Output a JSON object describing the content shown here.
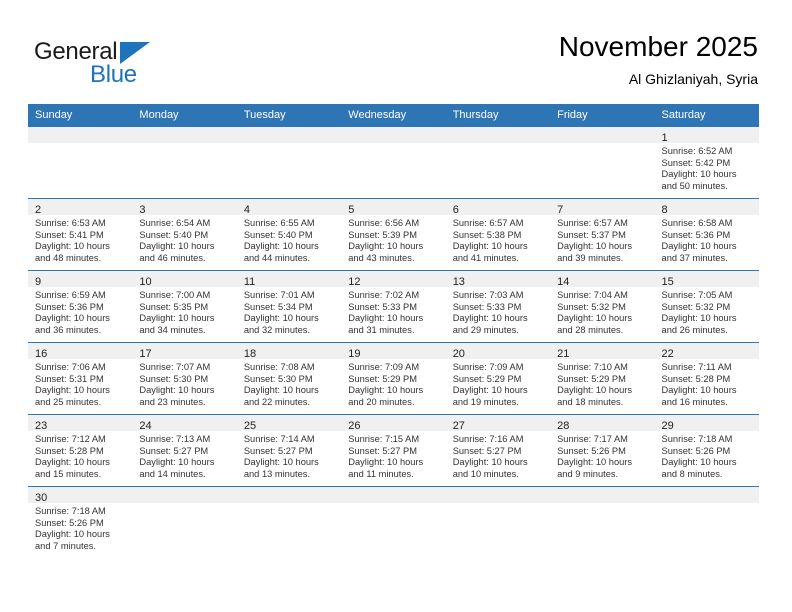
{
  "brand": {
    "name_part1": "General",
    "name_part2": "Blue"
  },
  "header": {
    "title": "November 2025",
    "subtitle": "Al Ghizlaniyah, Syria"
  },
  "weekdays": [
    "Sunday",
    "Monday",
    "Tuesday",
    "Wednesday",
    "Thursday",
    "Friday",
    "Saturday"
  ],
  "colors": {
    "header_blue": "#2e75b6",
    "brand_blue": "#1d74bb",
    "daynum_band": "#f0f0f0"
  },
  "labels": {
    "sunrise": "Sunrise:",
    "sunset": "Sunset:",
    "daylight": "Daylight:"
  },
  "weeks": [
    [
      {
        "day": "",
        "sunrise": "",
        "sunset": "",
        "daylight_line1": "",
        "daylight_line2": ""
      },
      {
        "day": "",
        "sunrise": "",
        "sunset": "",
        "daylight_line1": "",
        "daylight_line2": ""
      },
      {
        "day": "",
        "sunrise": "",
        "sunset": "",
        "daylight_line1": "",
        "daylight_line2": ""
      },
      {
        "day": "",
        "sunrise": "",
        "sunset": "",
        "daylight_line1": "",
        "daylight_line2": ""
      },
      {
        "day": "",
        "sunrise": "",
        "sunset": "",
        "daylight_line1": "",
        "daylight_line2": ""
      },
      {
        "day": "",
        "sunrise": "",
        "sunset": "",
        "daylight_line1": "",
        "daylight_line2": ""
      },
      {
        "day": "1",
        "sunrise": "Sunrise: 6:52 AM",
        "sunset": "Sunset: 5:42 PM",
        "daylight_line1": "Daylight: 10 hours",
        "daylight_line2": "and 50 minutes."
      }
    ],
    [
      {
        "day": "2",
        "sunrise": "Sunrise: 6:53 AM",
        "sunset": "Sunset: 5:41 PM",
        "daylight_line1": "Daylight: 10 hours",
        "daylight_line2": "and 48 minutes."
      },
      {
        "day": "3",
        "sunrise": "Sunrise: 6:54 AM",
        "sunset": "Sunset: 5:40 PM",
        "daylight_line1": "Daylight: 10 hours",
        "daylight_line2": "and 46 minutes."
      },
      {
        "day": "4",
        "sunrise": "Sunrise: 6:55 AM",
        "sunset": "Sunset: 5:40 PM",
        "daylight_line1": "Daylight: 10 hours",
        "daylight_line2": "and 44 minutes."
      },
      {
        "day": "5",
        "sunrise": "Sunrise: 6:56 AM",
        "sunset": "Sunset: 5:39 PM",
        "daylight_line1": "Daylight: 10 hours",
        "daylight_line2": "and 43 minutes."
      },
      {
        "day": "6",
        "sunrise": "Sunrise: 6:57 AM",
        "sunset": "Sunset: 5:38 PM",
        "daylight_line1": "Daylight: 10 hours",
        "daylight_line2": "and 41 minutes."
      },
      {
        "day": "7",
        "sunrise": "Sunrise: 6:57 AM",
        "sunset": "Sunset: 5:37 PM",
        "daylight_line1": "Daylight: 10 hours",
        "daylight_line2": "and 39 minutes."
      },
      {
        "day": "8",
        "sunrise": "Sunrise: 6:58 AM",
        "sunset": "Sunset: 5:36 PM",
        "daylight_line1": "Daylight: 10 hours",
        "daylight_line2": "and 37 minutes."
      }
    ],
    [
      {
        "day": "9",
        "sunrise": "Sunrise: 6:59 AM",
        "sunset": "Sunset: 5:36 PM",
        "daylight_line1": "Daylight: 10 hours",
        "daylight_line2": "and 36 minutes."
      },
      {
        "day": "10",
        "sunrise": "Sunrise: 7:00 AM",
        "sunset": "Sunset: 5:35 PM",
        "daylight_line1": "Daylight: 10 hours",
        "daylight_line2": "and 34 minutes."
      },
      {
        "day": "11",
        "sunrise": "Sunrise: 7:01 AM",
        "sunset": "Sunset: 5:34 PM",
        "daylight_line1": "Daylight: 10 hours",
        "daylight_line2": "and 32 minutes."
      },
      {
        "day": "12",
        "sunrise": "Sunrise: 7:02 AM",
        "sunset": "Sunset: 5:33 PM",
        "daylight_line1": "Daylight: 10 hours",
        "daylight_line2": "and 31 minutes."
      },
      {
        "day": "13",
        "sunrise": "Sunrise: 7:03 AM",
        "sunset": "Sunset: 5:33 PM",
        "daylight_line1": "Daylight: 10 hours",
        "daylight_line2": "and 29 minutes."
      },
      {
        "day": "14",
        "sunrise": "Sunrise: 7:04 AM",
        "sunset": "Sunset: 5:32 PM",
        "daylight_line1": "Daylight: 10 hours",
        "daylight_line2": "and 28 minutes."
      },
      {
        "day": "15",
        "sunrise": "Sunrise: 7:05 AM",
        "sunset": "Sunset: 5:32 PM",
        "daylight_line1": "Daylight: 10 hours",
        "daylight_line2": "and 26 minutes."
      }
    ],
    [
      {
        "day": "16",
        "sunrise": "Sunrise: 7:06 AM",
        "sunset": "Sunset: 5:31 PM",
        "daylight_line1": "Daylight: 10 hours",
        "daylight_line2": "and 25 minutes."
      },
      {
        "day": "17",
        "sunrise": "Sunrise: 7:07 AM",
        "sunset": "Sunset: 5:30 PM",
        "daylight_line1": "Daylight: 10 hours",
        "daylight_line2": "and 23 minutes."
      },
      {
        "day": "18",
        "sunrise": "Sunrise: 7:08 AM",
        "sunset": "Sunset: 5:30 PM",
        "daylight_line1": "Daylight: 10 hours",
        "daylight_line2": "and 22 minutes."
      },
      {
        "day": "19",
        "sunrise": "Sunrise: 7:09 AM",
        "sunset": "Sunset: 5:29 PM",
        "daylight_line1": "Daylight: 10 hours",
        "daylight_line2": "and 20 minutes."
      },
      {
        "day": "20",
        "sunrise": "Sunrise: 7:09 AM",
        "sunset": "Sunset: 5:29 PM",
        "daylight_line1": "Daylight: 10 hours",
        "daylight_line2": "and 19 minutes."
      },
      {
        "day": "21",
        "sunrise": "Sunrise: 7:10 AM",
        "sunset": "Sunset: 5:29 PM",
        "daylight_line1": "Daylight: 10 hours",
        "daylight_line2": "and 18 minutes."
      },
      {
        "day": "22",
        "sunrise": "Sunrise: 7:11 AM",
        "sunset": "Sunset: 5:28 PM",
        "daylight_line1": "Daylight: 10 hours",
        "daylight_line2": "and 16 minutes."
      }
    ],
    [
      {
        "day": "23",
        "sunrise": "Sunrise: 7:12 AM",
        "sunset": "Sunset: 5:28 PM",
        "daylight_line1": "Daylight: 10 hours",
        "daylight_line2": "and 15 minutes."
      },
      {
        "day": "24",
        "sunrise": "Sunrise: 7:13 AM",
        "sunset": "Sunset: 5:27 PM",
        "daylight_line1": "Daylight: 10 hours",
        "daylight_line2": "and 14 minutes."
      },
      {
        "day": "25",
        "sunrise": "Sunrise: 7:14 AM",
        "sunset": "Sunset: 5:27 PM",
        "daylight_line1": "Daylight: 10 hours",
        "daylight_line2": "and 13 minutes."
      },
      {
        "day": "26",
        "sunrise": "Sunrise: 7:15 AM",
        "sunset": "Sunset: 5:27 PM",
        "daylight_line1": "Daylight: 10 hours",
        "daylight_line2": "and 11 minutes."
      },
      {
        "day": "27",
        "sunrise": "Sunrise: 7:16 AM",
        "sunset": "Sunset: 5:27 PM",
        "daylight_line1": "Daylight: 10 hours",
        "daylight_line2": "and 10 minutes."
      },
      {
        "day": "28",
        "sunrise": "Sunrise: 7:17 AM",
        "sunset": "Sunset: 5:26 PM",
        "daylight_line1": "Daylight: 10 hours",
        "daylight_line2": "and 9 minutes."
      },
      {
        "day": "29",
        "sunrise": "Sunrise: 7:18 AM",
        "sunset": "Sunset: 5:26 PM",
        "daylight_line1": "Daylight: 10 hours",
        "daylight_line2": "and 8 minutes."
      }
    ],
    [
      {
        "day": "30",
        "sunrise": "Sunrise: 7:18 AM",
        "sunset": "Sunset: 5:26 PM",
        "daylight_line1": "Daylight: 10 hours",
        "daylight_line2": "and 7 minutes."
      },
      {
        "day": "",
        "sunrise": "",
        "sunset": "",
        "daylight_line1": "",
        "daylight_line2": ""
      },
      {
        "day": "",
        "sunrise": "",
        "sunset": "",
        "daylight_line1": "",
        "daylight_line2": ""
      },
      {
        "day": "",
        "sunrise": "",
        "sunset": "",
        "daylight_line1": "",
        "daylight_line2": ""
      },
      {
        "day": "",
        "sunrise": "",
        "sunset": "",
        "daylight_line1": "",
        "daylight_line2": ""
      },
      {
        "day": "",
        "sunrise": "",
        "sunset": "",
        "daylight_line1": "",
        "daylight_line2": ""
      },
      {
        "day": "",
        "sunrise": "",
        "sunset": "",
        "daylight_line1": "",
        "daylight_line2": ""
      }
    ]
  ]
}
